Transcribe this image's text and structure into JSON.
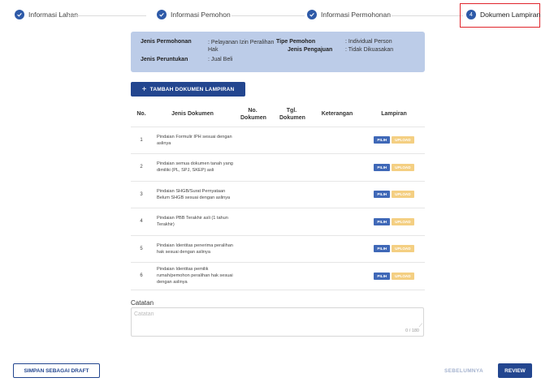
{
  "stepper": {
    "steps": [
      {
        "label": "Informasi Lahan",
        "state": "done"
      },
      {
        "label": "Informasi Pemohon",
        "state": "done"
      },
      {
        "label": "Informasi Permohonan",
        "state": "done"
      },
      {
        "label": "Dokumen Lampiran",
        "state": "active",
        "number": "4"
      }
    ]
  },
  "info": {
    "jenis_permohonan_label": "Jenis Permohonan",
    "jenis_permohonan_value": ": Pelayanan Izin Peralihan Hak",
    "jenis_peruntukan_label": "Jenis Peruntukan",
    "jenis_peruntukan_value": ": Jual Beli",
    "tipe_pemohon_label": "Tipe Pemohon",
    "tipe_pemohon_value": ": Individual Person",
    "jenis_pengajuan_label": "Jenis Pengajuan",
    "jenis_pengajuan_value": ": Tidak Dikuasakan"
  },
  "add_button": {
    "icon": "plus-icon",
    "label": "TAMBAH DOKUMEN LAMPIRAN"
  },
  "table": {
    "headers": [
      "No.",
      "Jenis Dokumen",
      "No. Dokumen",
      "Tgl. Dokumen",
      "Keterangan",
      "Lampiran"
    ],
    "rows": [
      {
        "no": "1",
        "jenis": "Pindaian Formulir IPH sesuai dengan aslinya"
      },
      {
        "no": "2",
        "jenis": "Pindaian semua dokumen tanah yang dimiliki (PL, SPJ, SKEP) asli"
      },
      {
        "no": "3",
        "jenis": "Pindaian SHGB/Surat Pernyataan Belum SHGB sesuai dengan aslinya"
      },
      {
        "no": "4",
        "jenis": "Pindaian PBB Terakhir asli (1 tahun Terakhir)"
      },
      {
        "no": "5",
        "jenis": "Pindaian Identitas penerima peralihan hak sesuai dengan aslinya"
      },
      {
        "no": "6",
        "jenis": "Pindaian Identitas pemilik rumah/pemohon peralihan hak sesuai dengan aslinya"
      }
    ],
    "pilih_label": "PILIH",
    "upload_label": "UPLOAD"
  },
  "catatan": {
    "label": "Catatan",
    "placeholder": "Catatan",
    "counter": "0 / 180"
  },
  "footer": {
    "draft_label": "SIMPAN SEBAGAI DRAFT",
    "prev_label": "SEBELUMNYA",
    "review_label": "REVIEW"
  },
  "colors": {
    "primary": "#23468f",
    "accent_red": "#e0242b",
    "info_bg": "#bccce8",
    "upload": "#f4cf82"
  }
}
